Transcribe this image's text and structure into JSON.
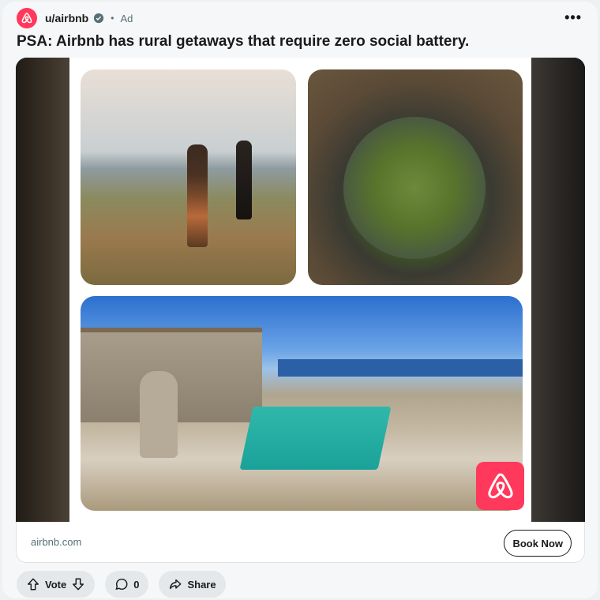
{
  "post": {
    "username": "u/airbnb",
    "separator": "•",
    "ad_label": "Ad",
    "more_label": "•••",
    "title": "PSA: Airbnb has rural getaways that require zero social battery."
  },
  "media": {
    "images": [
      {
        "name": "hiking-photo"
      },
      {
        "name": "food-photo"
      },
      {
        "name": "villa-pool-photo"
      }
    ],
    "logo": "airbnb-logo-icon"
  },
  "footer": {
    "domain": "airbnb.com",
    "cta_label": "Book Now"
  },
  "actions": {
    "vote_label": "Vote",
    "comment_count": "0",
    "share_label": "Share"
  },
  "colors": {
    "brand": "#ff385c",
    "text": "#1a1a1b",
    "muted": "#576f76",
    "pill_bg": "#e4e8ea"
  }
}
